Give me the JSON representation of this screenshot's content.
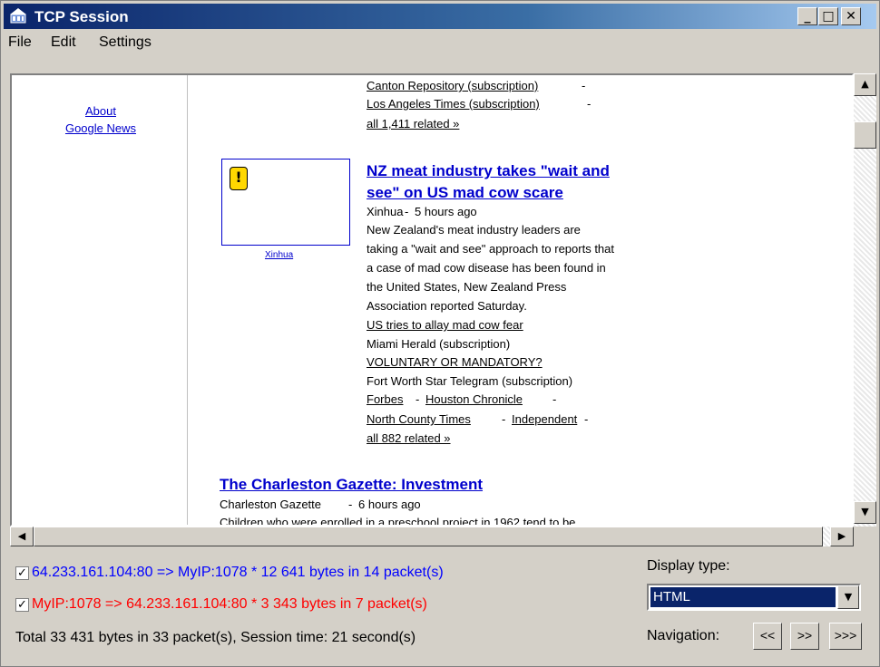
{
  "window": {
    "title": "TCP Session"
  },
  "menu": [
    "File",
    "Edit",
    "Settings"
  ],
  "left_nav": {
    "about": "About",
    "google_news": "Google News"
  },
  "article1": {
    "related_line1": "Canton Repository (subscription)",
    "related_line2": "Los Angeles Times (subscription)",
    "all_related": "all 1,411 related »"
  },
  "article2": {
    "image_caption": "Xinhua",
    "headline_line1": "NZ meat industry takes \"wait and",
    "headline_line2": "see\" on US mad cow scare",
    "source": "Xinhua",
    "age": "5 hours ago",
    "body": [
      "New Zealand's meat industry leaders are",
      "taking a \"wait and see\" approach to reports that",
      "a case of mad cow disease has been found in",
      "the United States, New Zealand Press",
      "Association reported Saturday."
    ],
    "related": [
      {
        "title": "US tries to allay mad cow fear",
        "source": "Miami Herald (subscription)"
      },
      {
        "title": "VOLUNTARY OR MANDATORY?",
        "source": "Fort Worth Star Telegram (subscription)"
      }
    ],
    "links_row1": [
      "Forbes",
      "Houston Chronicle"
    ],
    "links_row2": [
      "North County Times",
      "Independent"
    ],
    "all_related": "all 882 related »"
  },
  "article3": {
    "headline": "The Charleston Gazette: Investment",
    "source": "Charleston Gazette",
    "age": "6 hours ago",
    "body_partial": "Children who were enrolled in a preschool project in 1962 tend to be"
  },
  "stats": {
    "incoming": "64.233.161.104:80 => MyIP:1078 * 12 641 bytes in 14 packet(s)",
    "outgoing": "MyIP:1078 => 64.233.161.104:80 * 3 343 bytes in 7 packet(s)",
    "total": "Total 33 431 bytes in 33 packet(s), Session time: 21 second(s)",
    "incoming_color": "#0000ff",
    "outgoing_color": "#ff0000"
  },
  "display": {
    "label": "Display type:",
    "value": "HTML"
  },
  "navigation": {
    "label": "Navigation:",
    "buttons": [
      "<<",
      ">>",
      ">>>"
    ]
  }
}
